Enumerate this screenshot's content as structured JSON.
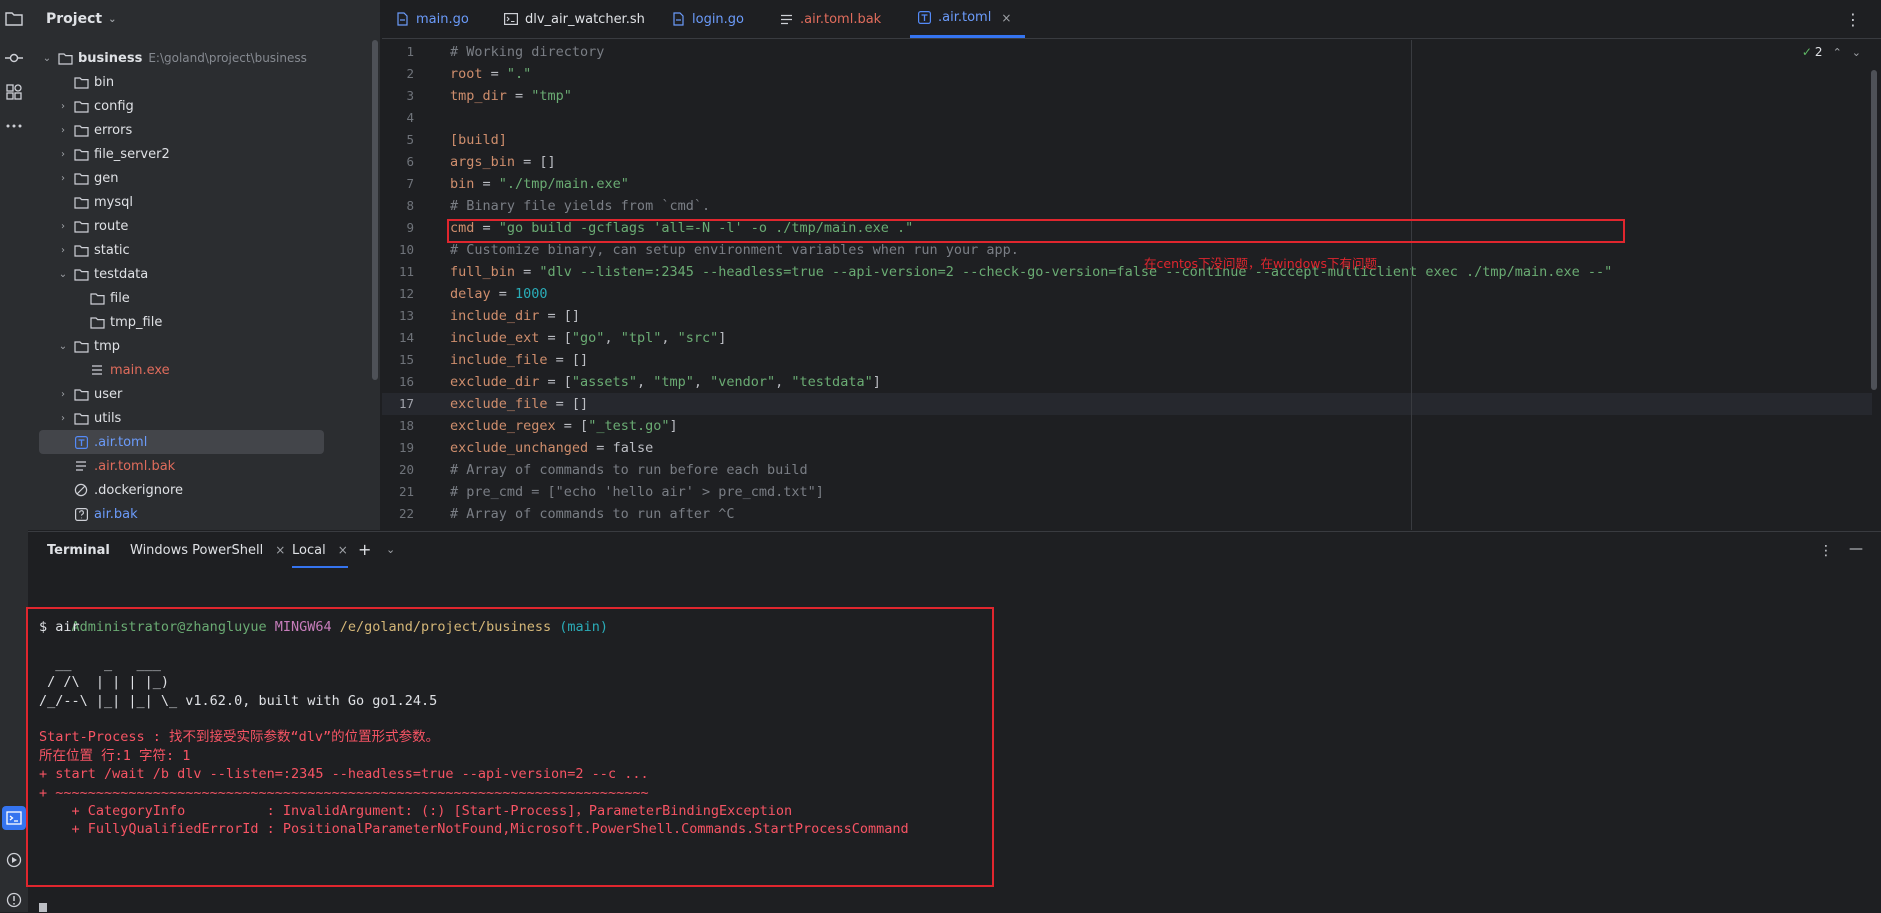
{
  "project": {
    "title": "Project",
    "root": {
      "name": "business",
      "path": "E:\\goland\\project\\business"
    },
    "items": [
      {
        "name": "bin",
        "kind": "folder",
        "depth": 1,
        "arrow": ""
      },
      {
        "name": "config",
        "kind": "folder",
        "depth": 1,
        "arrow": "›"
      },
      {
        "name": "errors",
        "kind": "folder",
        "depth": 1,
        "arrow": "›"
      },
      {
        "name": "file_server2",
        "kind": "folder",
        "depth": 1,
        "arrow": "›"
      },
      {
        "name": "gen",
        "kind": "folder",
        "depth": 1,
        "arrow": "›"
      },
      {
        "name": "mysql",
        "kind": "folder",
        "depth": 1,
        "arrow": ""
      },
      {
        "name": "route",
        "kind": "folder",
        "depth": 1,
        "arrow": "›"
      },
      {
        "name": "static",
        "kind": "folder",
        "depth": 1,
        "arrow": "›"
      },
      {
        "name": "testdata",
        "kind": "folder",
        "depth": 1,
        "arrow": "⌄"
      },
      {
        "name": "file",
        "kind": "folder",
        "depth": 2,
        "arrow": ""
      },
      {
        "name": "tmp_file",
        "kind": "folder",
        "depth": 2,
        "arrow": ""
      },
      {
        "name": "tmp",
        "kind": "folder",
        "depth": 1,
        "arrow": "⌄"
      },
      {
        "name": "main.exe",
        "kind": "exe",
        "depth": 2,
        "arrow": ""
      },
      {
        "name": "user",
        "kind": "folder",
        "depth": 1,
        "arrow": "›"
      },
      {
        "name": "utils",
        "kind": "folder",
        "depth": 1,
        "arrow": "›"
      },
      {
        "name": ".air.toml",
        "kind": "toml",
        "depth": 1,
        "arrow": "",
        "selected": true
      },
      {
        "name": ".air.toml.bak",
        "kind": "bak",
        "depth": 1,
        "arrow": ""
      },
      {
        "name": ".dockerignore",
        "kind": "ignore",
        "depth": 1,
        "arrow": ""
      },
      {
        "name": "air.bak",
        "kind": "unknown",
        "depth": 1,
        "arrow": ""
      }
    ]
  },
  "tabs": [
    {
      "label": "main.go",
      "icon": "go-file-icon"
    },
    {
      "label": "dlv_air_watcher.sh",
      "icon": "shell-file-icon"
    },
    {
      "label": "login.go",
      "icon": "go-file-icon"
    },
    {
      "label": ".air.toml.bak",
      "icon": "text-file-icon"
    },
    {
      "label": ".air.toml",
      "icon": "toml-file-icon",
      "active": true,
      "close": "×"
    }
  ],
  "inspection": {
    "count": "2"
  },
  "code": [
    {
      "n": "1",
      "parts": [
        [
          "c-comment",
          "# Working directory"
        ]
      ]
    },
    {
      "n": "2",
      "parts": [
        [
          "c-key",
          "root"
        ],
        [
          "c-plain",
          " = "
        ],
        [
          "c-str",
          "\".\""
        ]
      ]
    },
    {
      "n": "3",
      "parts": [
        [
          "c-key",
          "tmp_dir"
        ],
        [
          "c-plain",
          " = "
        ],
        [
          "c-str",
          "\"tmp\""
        ]
      ]
    },
    {
      "n": "4",
      "parts": []
    },
    {
      "n": "5",
      "parts": [
        [
          "c-key",
          "[build]"
        ]
      ]
    },
    {
      "n": "6",
      "parts": [
        [
          "c-key",
          "args_bin"
        ],
        [
          "c-plain",
          " = []"
        ]
      ]
    },
    {
      "n": "7",
      "parts": [
        [
          "c-key",
          "bin"
        ],
        [
          "c-plain",
          " = "
        ],
        [
          "c-str",
          "\"./tmp/main.exe\""
        ]
      ]
    },
    {
      "n": "8",
      "parts": [
        [
          "c-comment",
          "# Binary file yields from `cmd`."
        ]
      ]
    },
    {
      "n": "9",
      "parts": [
        [
          "c-key",
          "cmd"
        ],
        [
          "c-plain",
          " = "
        ],
        [
          "c-str",
          "\"go build -gcflags 'all=-N -l' -o ./tmp/main.exe .\""
        ]
      ]
    },
    {
      "n": "10",
      "parts": [
        [
          "c-comment",
          "# Customize binary, can setup environment variables when run your app."
        ]
      ]
    },
    {
      "n": "11",
      "parts": [
        [
          "c-key",
          "full_bin"
        ],
        [
          "c-plain",
          " = "
        ],
        [
          "c-str",
          "\"dlv --listen=:2345 --headless=true --api-version=2 --check-go-version=false --continue --accept-multiclient exec ./tmp/main.exe --\""
        ]
      ]
    },
    {
      "n": "12",
      "parts": [
        [
          "c-key",
          "delay"
        ],
        [
          "c-plain",
          " = "
        ],
        [
          "c-num",
          "1000"
        ]
      ]
    },
    {
      "n": "13",
      "parts": [
        [
          "c-key",
          "include_dir"
        ],
        [
          "c-plain",
          " = []"
        ]
      ]
    },
    {
      "n": "14",
      "parts": [
        [
          "c-key",
          "include_ext"
        ],
        [
          "c-plain",
          " = ["
        ],
        [
          "c-str",
          "\"go\""
        ],
        [
          "c-plain",
          ", "
        ],
        [
          "c-str",
          "\"tpl\""
        ],
        [
          "c-plain",
          ", "
        ],
        [
          "c-str",
          "\"src\""
        ],
        [
          "c-plain",
          "]"
        ]
      ]
    },
    {
      "n": "15",
      "parts": [
        [
          "c-key",
          "include_file"
        ],
        [
          "c-plain",
          " = []"
        ]
      ]
    },
    {
      "n": "16",
      "parts": [
        [
          "c-key",
          "exclude_dir"
        ],
        [
          "c-plain",
          " = ["
        ],
        [
          "c-str",
          "\"assets\""
        ],
        [
          "c-plain",
          ", "
        ],
        [
          "c-str",
          "\"tmp\""
        ],
        [
          "c-plain",
          ", "
        ],
        [
          "c-str",
          "\"vendor\""
        ],
        [
          "c-plain",
          ", "
        ],
        [
          "c-str",
          "\"testdata\""
        ],
        [
          "c-plain",
          "]"
        ]
      ]
    },
    {
      "n": "17",
      "parts": [
        [
          "c-key",
          "exclude_file"
        ],
        [
          "c-plain",
          " = []"
        ]
      ],
      "current": true
    },
    {
      "n": "18",
      "parts": [
        [
          "c-key",
          "exclude_regex"
        ],
        [
          "c-plain",
          " = ["
        ],
        [
          "c-str",
          "\"_test.go\""
        ],
        [
          "c-plain",
          "]"
        ]
      ]
    },
    {
      "n": "19",
      "parts": [
        [
          "c-key",
          "exclude_unchanged"
        ],
        [
          "c-plain",
          " = "
        ],
        [
          "c-plain",
          "false"
        ]
      ]
    },
    {
      "n": "20",
      "parts": [
        [
          "c-comment",
          "# Array of commands to run before each build"
        ]
      ]
    },
    {
      "n": "21",
      "parts": [
        [
          "c-comment",
          "# pre_cmd = [\"echo 'hello air' > pre_cmd.txt\"]"
        ]
      ]
    },
    {
      "n": "22",
      "parts": [
        [
          "c-comment",
          "# Array of commands to run after ^C"
        ]
      ]
    }
  ],
  "annotation": "在centos下没问题，在windows下有问题",
  "terminal": {
    "title": "Terminal",
    "tabs": [
      {
        "label": "Windows PowerShell",
        "close": "×"
      },
      {
        "label": "Local",
        "close": "×",
        "active": true
      }
    ],
    "prompt": {
      "user": "Administrator@zhangluyue",
      "shell": "MINGW64",
      "path": "/e/goland/project/business",
      "branch": "(main)"
    },
    "lines": [
      {
        "cls": "t-white",
        "text": "$ air"
      },
      {
        "cls": "t-white",
        "text": ""
      },
      {
        "cls": "t-white",
        "text": "  __    _   ___"
      },
      {
        "cls": "t-white",
        "text": " / /\\  | | | |_)"
      },
      {
        "cls": "t-white",
        "text": "/_/--\\ |_| |_| \\_ v1.62.0, built with Go go1.24.5"
      },
      {
        "cls": "t-white",
        "text": ""
      },
      {
        "cls": "t-red",
        "text": "Start-Process : 找不到接受实际参数“dlv”的位置形式参数。"
      },
      {
        "cls": "t-red",
        "text": "所在位置 行:1 字符: 1"
      },
      {
        "cls": "t-red",
        "text": "+ start /wait /b dlv --listen=:2345 --headless=true --api-version=2 --c ..."
      },
      {
        "cls": "t-red",
        "text": "+ ~~~~~~~~~~~~~~~~~~~~~~~~~~~~~~~~~~~~~~~~~~~~~~~~~~~~~~~~~~~~~~~~~~~~~~~~~"
      },
      {
        "cls": "t-red",
        "text": "    + CategoryInfo          : InvalidArgument: (:) [Start-Process]，ParameterBindingException"
      },
      {
        "cls": "t-red",
        "text": "    + FullyQualifiedErrorId : PositionalParameterNotFound,Microsoft.PowerShell.Commands.StartProcessCommand"
      }
    ]
  }
}
